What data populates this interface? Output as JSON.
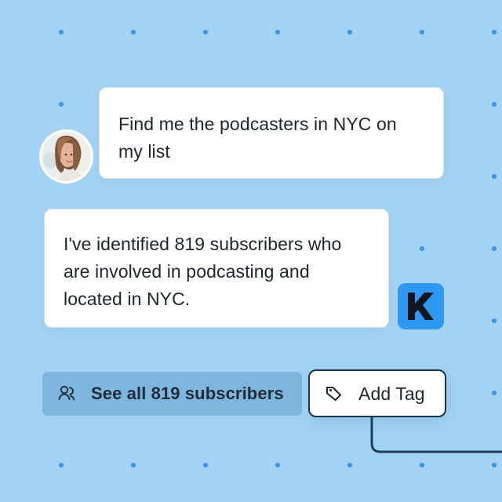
{
  "conversation": {
    "user_message": "Find me the podcasters in NYC on my list",
    "assistant_message": "I've identified 819 subscribers who are involved in podcasting and located in NYC."
  },
  "actions": {
    "see_all_label": "See all 819 subscribers",
    "add_tag_label": "Add Tag"
  },
  "icons": {
    "avatar": "user-avatar",
    "brand": "brand-logo-k",
    "see_all": "users-icon",
    "add_tag": "tag-icon"
  },
  "colors": {
    "background": "#a4d2f2",
    "dot": "#2f8fe8",
    "bubble": "#ffffff",
    "primary_text": "#1d2430",
    "secondary_button": "#7eb6df",
    "add_tag_border": "#18344f",
    "brand_badge": "#2f98f0",
    "connector": "#1d3d59"
  }
}
